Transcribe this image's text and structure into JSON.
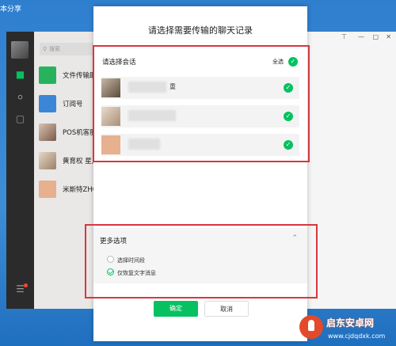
{
  "desktop": {
    "title": "本分享"
  },
  "search": {
    "icon": "search-icon",
    "placeholder": "搜索"
  },
  "chat_list": [
    {
      "name": "文件传输助",
      "avatar": "file-transfer-icon"
    },
    {
      "name": "订阅号",
      "avatar": "subscription-icon"
    },
    {
      "name": "POS机客服",
      "avatar": "photo-avatar"
    },
    {
      "name": "黄育权 星点",
      "avatar": "photo-avatar"
    },
    {
      "name": "米斯特ZHC",
      "avatar": "cat-avatar"
    }
  ],
  "dialog": {
    "title": "请选择需要传输的聊天记录",
    "select_label": "请选择会话",
    "select_all": "全选",
    "conversations": [
      {
        "name_suffix": "重",
        "checked": true
      },
      {
        "name_suffix": "",
        "checked": true
      },
      {
        "name_suffix": "",
        "checked": true
      }
    ],
    "more_options": "更多选项",
    "options": [
      {
        "label": "选择时间段",
        "selected": false
      },
      {
        "label": "仅恢复文字消息",
        "selected": true
      }
    ],
    "ok": "确定",
    "cancel": "取消"
  },
  "watermark": {
    "cn": "启东安卓网",
    "en": "www.cjdqdxk.com"
  },
  "colors": {
    "accent": "#07c160",
    "annotation": "#d9363e"
  }
}
